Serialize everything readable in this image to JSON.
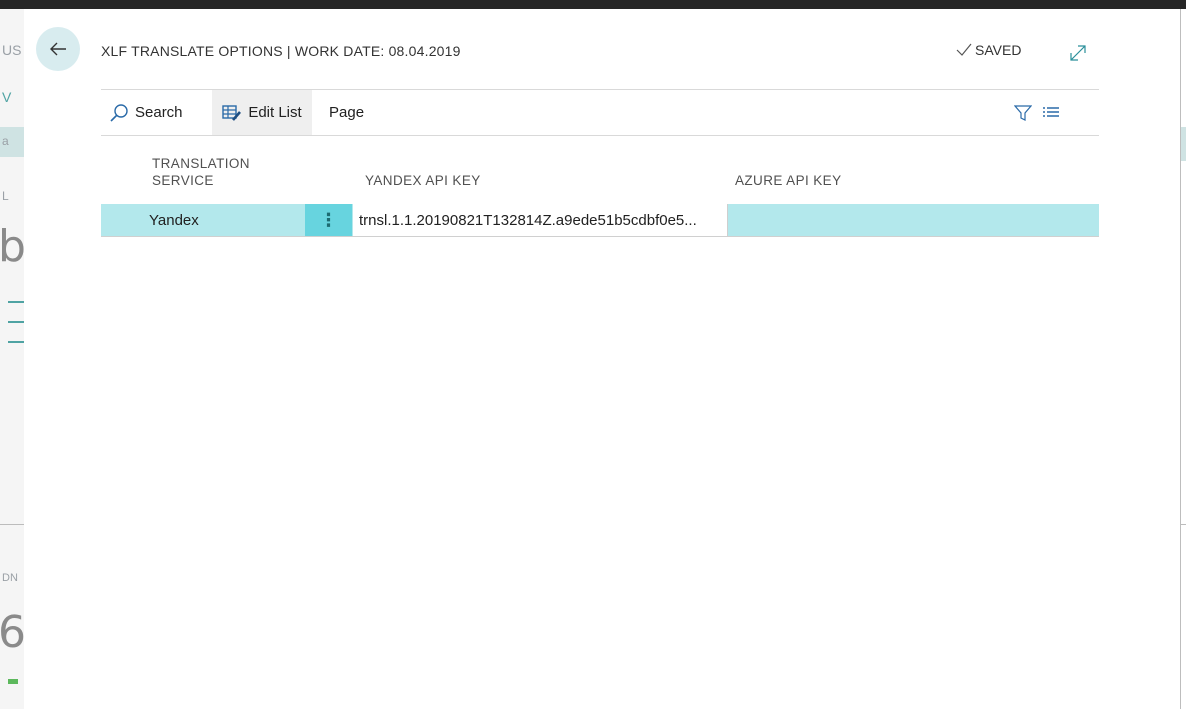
{
  "dialog": {
    "title": "XLF TRANSLATE OPTIONS | WORK DATE: 08.04.2019",
    "saved_label": "SAVED"
  },
  "toolbar": {
    "search_label": "Search",
    "edit_list_label": "Edit List",
    "page_label": "Page"
  },
  "table": {
    "columns": [
      {
        "line1": "TRANSLATION",
        "line2": "SERVICE"
      },
      {
        "label": "YANDEX API KEY"
      },
      {
        "label": "AZURE API KEY"
      }
    ],
    "rows": [
      {
        "service": "Yandex",
        "yandex_api_key": "trnsl.1.1.20190821T132814Z.a9ede51b5cdbf0e5...",
        "azure_api_key": ""
      }
    ]
  },
  "background": {
    "fragments": [
      "US",
      "V",
      "a",
      "L",
      "b",
      "DN",
      "6"
    ]
  },
  "colors": {
    "selected_row": "#b3e8ec",
    "row_menu": "#67d4df",
    "back_button": "#d8ecef",
    "top_bar": "#262626"
  },
  "icons": [
    "back-arrow-icon",
    "checkmark-icon",
    "expand-icon",
    "search-icon",
    "edit-list-icon",
    "filter-icon",
    "list-view-icon",
    "more-vertical-icon"
  ]
}
